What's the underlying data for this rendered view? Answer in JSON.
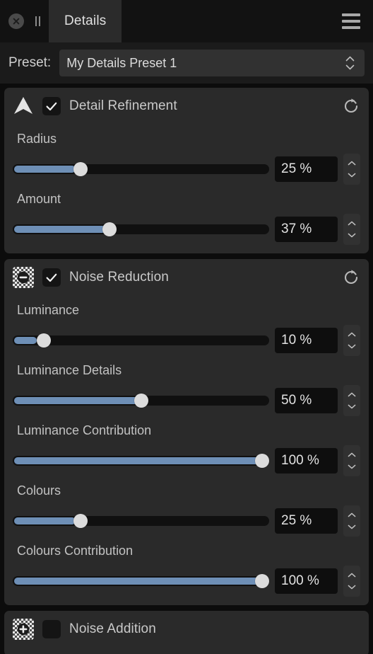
{
  "titlebar": {
    "close_icon": "close-circle-icon",
    "pause_icon": "pause-icon",
    "menu_icon": "hamburger-menu-icon",
    "tab_label": "Details"
  },
  "preset": {
    "label": "Preset:",
    "value": "My Details Preset 1",
    "stepper_icon": "up-down-chevron-icon"
  },
  "colors": {
    "app_background": "#0c0c0c",
    "panel_background": "#2a2a2a",
    "titlebar_background": "#121212",
    "tab_active_background": "#2b2b2b",
    "preset_row_background": "#1b1b1b",
    "slider_fill": "#6e8fb6",
    "slider_track": "#101010",
    "slider_thumb": "#dcdcdc",
    "field_background": "#0e0e0e",
    "text": "#c8c8c8"
  },
  "panels": [
    {
      "id": "detail-refinement",
      "title": "Detail Refinement",
      "icon": "arrowhead-up-icon",
      "checked": true,
      "reset_icon": "reset-circular-arrow-icon",
      "controls": [
        {
          "label": "Radius",
          "value": "25 %",
          "percent": 25
        },
        {
          "label": "Amount",
          "value": "37 %",
          "percent": 37
        }
      ]
    },
    {
      "id": "noise-reduction",
      "title": "Noise Reduction",
      "icon": "noise-minus-icon",
      "checked": true,
      "reset_icon": "reset-circular-arrow-icon",
      "controls": [
        {
          "label": "Luminance",
          "value": "10 %",
          "percent": 10
        },
        {
          "label": "Luminance Details",
          "value": "50 %",
          "percent": 50
        },
        {
          "label": "Luminance Contribution",
          "value": "100 %",
          "percent": 100
        },
        {
          "label": "Colours",
          "value": "25 %",
          "percent": 25
        },
        {
          "label": "Colours Contribution",
          "value": "100 %",
          "percent": 100
        }
      ]
    },
    {
      "id": "noise-addition",
      "title": "Noise Addition",
      "icon": "noise-plus-icon",
      "checked": false,
      "reset_icon": null,
      "controls": []
    }
  ]
}
